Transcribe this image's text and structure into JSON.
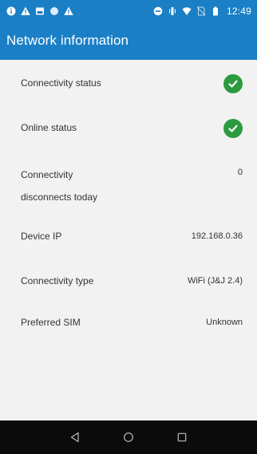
{
  "status_bar": {
    "time": "12:49",
    "left_icons": [
      "info-icon",
      "warning-icon",
      "image-icon",
      "circle-icon",
      "warning-icon"
    ],
    "right_icons": [
      "do-not-disturb-icon",
      "vibrate-icon",
      "wifi-icon",
      "no-sim-icon",
      "battery-icon"
    ]
  },
  "app_bar": {
    "title": "Network information"
  },
  "rows": [
    {
      "label": "Connectivity status",
      "value_icon": "check-circle-icon"
    },
    {
      "label": "Online status",
      "value_icon": "check-circle-icon"
    },
    {
      "label_line1": "Connectivity",
      "label_line2": "disconnects today",
      "value": "0"
    },
    {
      "label": "Device IP",
      "value": "192.168.0.36"
    },
    {
      "label": "Connectivity type",
      "value": "WiFi (J&J 2.4)"
    },
    {
      "label": "Preferred SIM",
      "value": "Unknown"
    }
  ],
  "colors": {
    "primary": "#1b7fc6",
    "success": "#2c9a3f",
    "nav_bar": "#0b0b0b",
    "background": "#f2f2f2"
  },
  "nav_bar": {
    "buttons": [
      "back-icon",
      "home-icon",
      "recents-icon"
    ]
  }
}
